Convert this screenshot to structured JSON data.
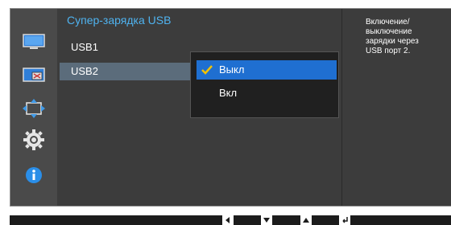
{
  "menu": {
    "title": "Супер-зарядка USB",
    "items": [
      {
        "label": "USB1"
      },
      {
        "label": "USB2"
      }
    ]
  },
  "popup": {
    "options": [
      {
        "label": "Выкл",
        "selected": true
      },
      {
        "label": "Вкл",
        "selected": false
      }
    ]
  },
  "help": {
    "text": "Включение/выключение\nзарядки через\nUSB порт 2."
  },
  "sidebar": {
    "icons": [
      "monitor-icon",
      "picture-in-picture-icon",
      "screen-size-icon",
      "settings-gear-icon",
      "info-icon"
    ]
  },
  "bottom_nav": {
    "buttons": [
      "left-arrow",
      "down-arrow",
      "up-arrow",
      "enter"
    ]
  },
  "colors": {
    "accent": "#4fb3f0",
    "selection": "#1f6fd1",
    "panel": "#3c3c3c"
  }
}
